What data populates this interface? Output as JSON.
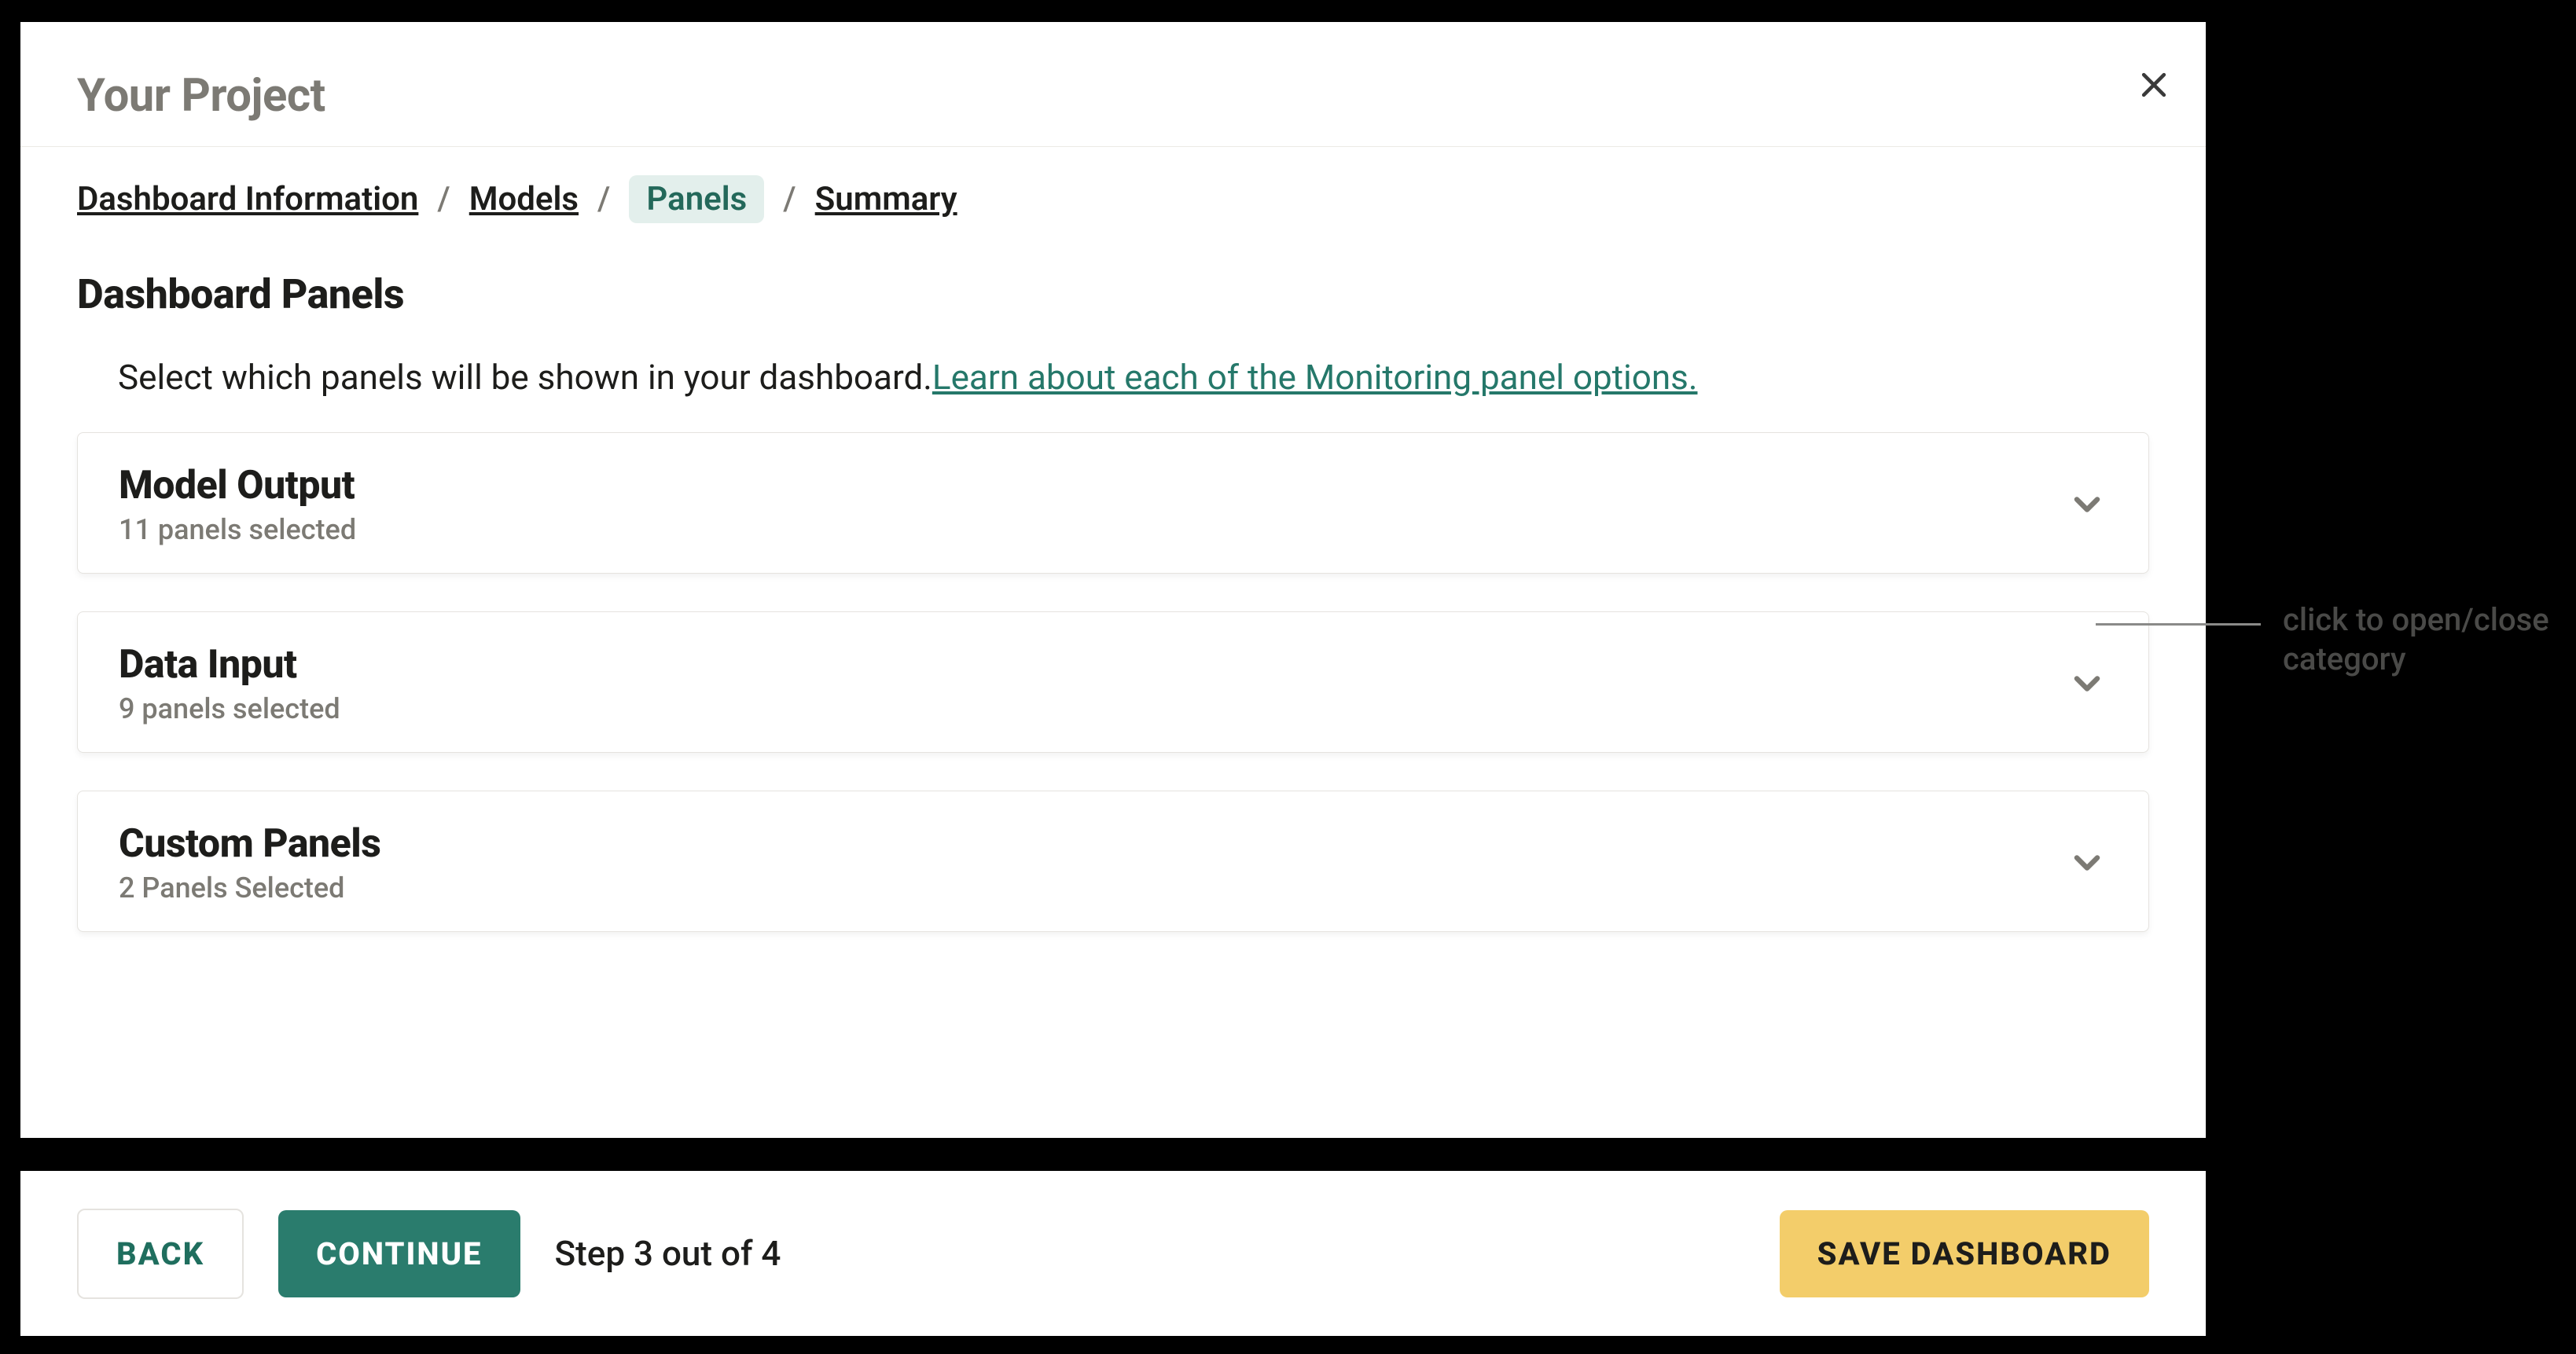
{
  "header": {
    "title": "Your Project"
  },
  "breadcrumbs": {
    "items": [
      "Dashboard Information",
      "Models",
      "Panels",
      "Summary"
    ],
    "active_index": 2
  },
  "page": {
    "title": "Dashboard Panels",
    "desc": "Select which panels will be shown in your dashboard.",
    "link": "Learn about each of the Monitoring panel options."
  },
  "categories": [
    {
      "title": "Model Output",
      "sub": "11 panels selected"
    },
    {
      "title": "Data Input",
      "sub": "9 panels selected"
    },
    {
      "title": "Custom Panels",
      "sub": "2 Panels Selected"
    }
  ],
  "footer": {
    "back": "BACK",
    "continue": "CONTINUE",
    "step": "Step 3 out of 4",
    "save": "SAVE DASHBOARD"
  },
  "callout": {
    "text": "click to open/close category"
  }
}
